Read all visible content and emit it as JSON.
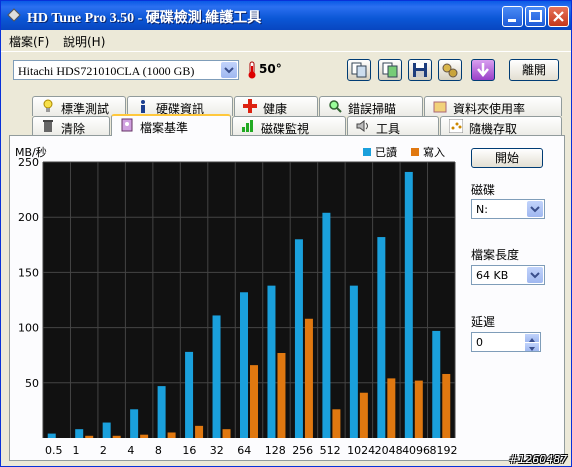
{
  "window": {
    "title": "HD Tune Pro 3.50 - 硬碟檢測.維護工具"
  },
  "menu": [
    {
      "label": "檔案(F)"
    },
    {
      "label": "說明(H)"
    }
  ],
  "toolbar": {
    "drive": "Hitachi HDS721010CLA (1000 GB)",
    "temperature": "50°",
    "exit_label": "離開"
  },
  "tabs_row1": [
    {
      "label": "標準測試"
    },
    {
      "label": "硬碟資訊"
    },
    {
      "label": "健康"
    },
    {
      "label": "錯誤掃瞄"
    },
    {
      "label": "資料夾使用率"
    }
  ],
  "tabs_row2": [
    {
      "label": "清除"
    },
    {
      "label": "檔案基準"
    },
    {
      "label": "磁碟監視"
    },
    {
      "label": "工具"
    },
    {
      "label": "隨機存取"
    }
  ],
  "controls": {
    "start_label": "開始",
    "disk_label": "磁碟",
    "disk_value": "N:",
    "file_length_label": "檔案長度",
    "file_length_value": "64 KB",
    "delay_label": "延遲",
    "delay_value": "0"
  },
  "watermark": "#1260487",
  "colors": {
    "read": "#1aa0dc",
    "write": "#e07810",
    "plot_bg": "#111111"
  },
  "chart_data": {
    "type": "bar",
    "ylabel": "MB/秒",
    "ylim": [
      0,
      250
    ],
    "yticks": [
      50,
      100,
      150,
      200,
      250
    ],
    "categories": [
      "0.5",
      "1",
      "2",
      "4",
      "8",
      "16",
      "32",
      "64",
      "128",
      "256",
      "512",
      "1024",
      "2048",
      "4096",
      "8192"
    ],
    "series": [
      {
        "name": "已讀",
        "values": [
          4,
          8,
          14,
          26,
          47,
          78,
          111,
          132,
          138,
          180,
          204,
          138,
          182,
          241,
          97
        ]
      },
      {
        "name": "寫入",
        "values": [
          0,
          2,
          2,
          3,
          5,
          11,
          8,
          66,
          77,
          108,
          26,
          41,
          54,
          52,
          58
        ]
      }
    ],
    "grid": true,
    "legend": "top-right"
  }
}
